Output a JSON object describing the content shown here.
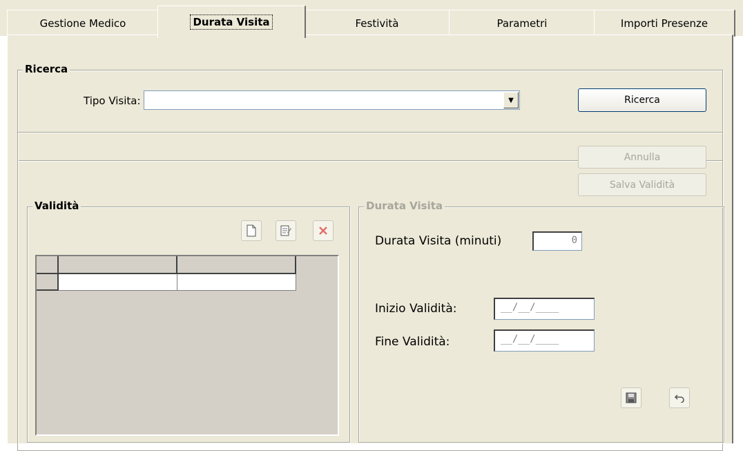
{
  "tabs": [
    {
      "label": "Gestione Medico"
    },
    {
      "label": "Durata Visita"
    },
    {
      "label": "Festività"
    },
    {
      "label": "Parametri"
    },
    {
      "label": "Importi Presenze"
    }
  ],
  "ricerca": {
    "legend": "Ricerca",
    "tipo_visita_label": "Tipo Visita:",
    "tipo_visita_value": "",
    "button": "Ricerca"
  },
  "actions": {
    "annulla": "Annulla",
    "salva": "Salva Validità"
  },
  "validita": {
    "legend": "Validità"
  },
  "durata": {
    "legend": "Durata Visita",
    "minuti_label": "Durata Visita (minuti)",
    "minuti_value": "0",
    "inizio_label": "Inizio Validità:",
    "inizio_value": "__/__/____",
    "fine_label": "Fine Validità:",
    "fine_value": "__/__/____"
  }
}
